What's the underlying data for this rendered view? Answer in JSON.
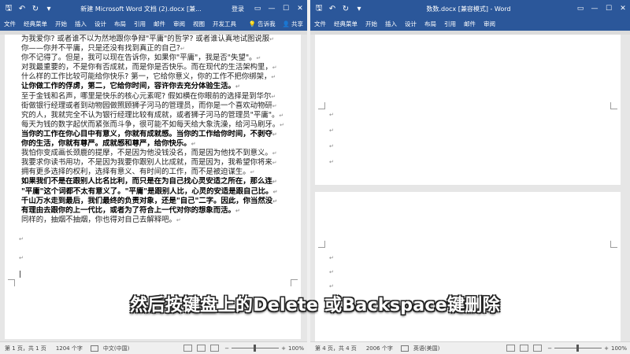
{
  "left_window": {
    "title": "新建 Microsoft Word 文档 (2).docx [兼...",
    "login": "登录",
    "tabs": [
      "文件",
      "经典菜单",
      "开始",
      "插入",
      "设计",
      "布局",
      "引用",
      "邮件",
      "审阅",
      "视图",
      "开发工具"
    ],
    "tell_me": "告诉我",
    "share": "共享",
    "body_lines": [
      {
        "t": "为我爱你? 或者谁不以为然地跟你争辩\"平庸\"的哲学? 或者谁认真地试图说服",
        "b": false
      },
      {
        "t": "你——你并不平庸，只是还没有找到真正的自己?",
        "b": false
      },
      {
        "t": "你不记得了。但是，我可以现在告诉你，如果你\"平庸\"，我是否\"失望\"。",
        "b": false
      },
      {
        "t": "对我最重要的，不是你有否成就，而是你是否快乐。而在现代的生活架构里，",
        "b": false
      },
      {
        "t": "什么样的工作比较可能给你快乐? 第一，它给你意义，你的工作不把你绑架，",
        "b": false
      },
      {
        "t": "让你做工作的俘虏，第二，它给你时间，容许你去充分体验生活。",
        "b": true
      },
      {
        "t": "至于金钱和名声，哪里是快乐的核心元素呢? 假如横在你眼前的选择是到华尔",
        "b": false
      },
      {
        "t": "街做银行经理或者到动物园做照顾狮子河马的管理员，而你是一个喜欢动物研",
        "b": false
      },
      {
        "t": "究的人，我就完全不认为银行经理比较有成就，或者狮子河马的管理员\"平庸\"。",
        "b": false
      },
      {
        "t": "每天为钱的数字起伏而紧张而斗争，很可能不如每天给大象洗澡，给河马刷牙。",
        "b": false
      },
      {
        "t": "当你的工作在你心目中有意义，你就有成就感。当你的工作给你时间，不剥夺",
        "b": true
      },
      {
        "t": "你的生活，你就有尊严。成就感和尊严，给你快乐。",
        "b": true
      },
      {
        "t": "我怕你变成画长颈鹿的提摩，不是因为他没钱没名，而是因为他找不到意义。",
        "b": false
      },
      {
        "t": "我要求你读书用功，不是因为我要你跟别人比成就，而是因为，我希望你将来",
        "b": false
      },
      {
        "t": "拥有更多选择的权利，选择有意义、有时间的工作，而不是被迫谋生。",
        "b": false
      },
      {
        "t": "如果我们不是在跟别人比名比利，而只是在为自己找心灵安适之所在，那么连",
        "b": true
      },
      {
        "t": "\"平庸\"这个词都不太有意义了。\"平庸\"是跟别人比，心灵的安适是跟自己比。",
        "b": true
      },
      {
        "t": "千山万水走到最后，我们最终的负责对象，还是\"自己\"二字。因此，你当然没",
        "b": true
      },
      {
        "t": "有理由去跟你的上一代比，或者为了符合上一代对你的想象而活。",
        "b": true
      },
      {
        "t": "同样的，抽烟不抽烟，你也得对自己去解释吧。",
        "b": false
      }
    ],
    "status": {
      "page": "第 1 页，共 1 页",
      "words": "1204 个字",
      "lang": "中文(中国)",
      "zoom": "100%"
    }
  },
  "right_window": {
    "title": "数数.docx [兼容模式] - Word",
    "tabs": [
      "文件",
      "经典菜单",
      "开始",
      "插入",
      "设计",
      "布局",
      "引用",
      "邮件",
      "审阅"
    ],
    "status": {
      "page": "第 4 页，共 4 页",
      "words": "2006 个字",
      "lang": "英语(美国)",
      "zoom": "100%"
    }
  },
  "subtitle": "然后按键盘上的Delete 或Backspace键删除",
  "colors": {
    "ribbon": "#2b579a",
    "page": "#ffffff",
    "workspace": "#e6e6e6"
  }
}
